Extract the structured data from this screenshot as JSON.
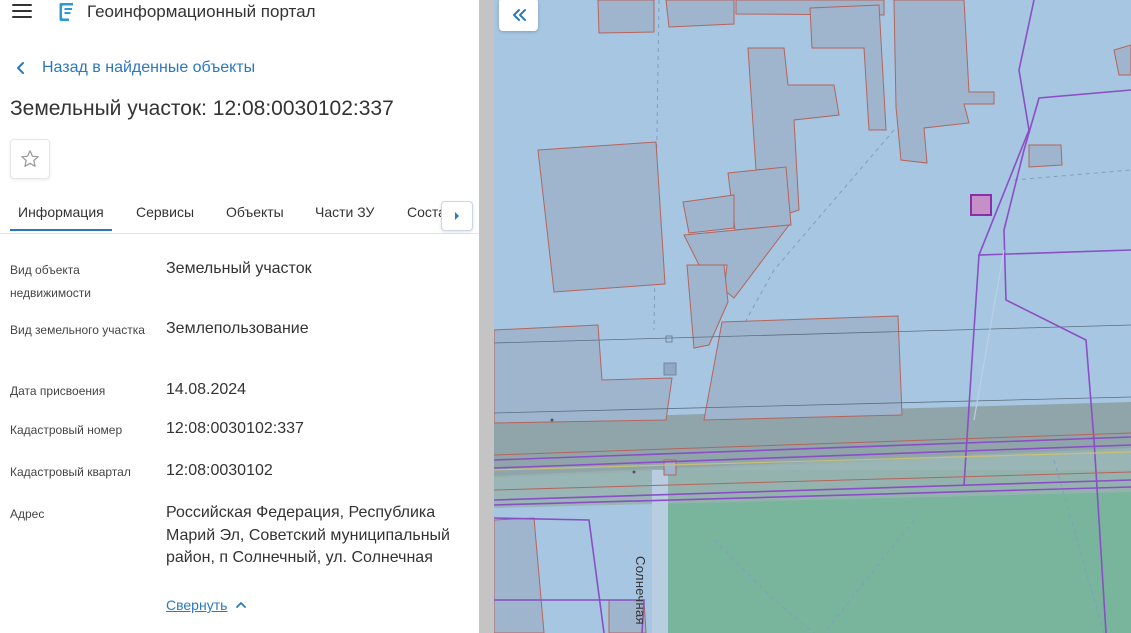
{
  "header": {
    "app_title": "Геоинформационный портал",
    "menu_icon": "hamburger-menu-icon",
    "logo_icon": "geoportal-logo-icon"
  },
  "back_link": {
    "label": "Назад в найденные объекты"
  },
  "object": {
    "title": "Земельный участок: 12:08:0030102:337"
  },
  "tabs": [
    {
      "label": "Информация",
      "active": true
    },
    {
      "label": "Сервисы",
      "active": false
    },
    {
      "label": "Объекты",
      "active": false
    },
    {
      "label": "Части ЗУ",
      "active": false
    },
    {
      "label": "Соста",
      "active": false
    }
  ],
  "details": [
    {
      "label": "Вид объекта недвижимости",
      "value": "Земельный участок"
    },
    {
      "label": "Вид земельного участка",
      "value": "Землепользование"
    },
    {
      "label": "Дата присвоения",
      "value": "14.08.2024"
    },
    {
      "label": "Кадастровый номер",
      "value": "12:08:0030102:337"
    },
    {
      "label": "Кадастровый квартал",
      "value": "12:08:0030102"
    },
    {
      "label": "Адрес",
      "value": "Российская Федерация, Республика Марий Эл, Советский муниципальный район, п Солнечный, ул. Солнечная"
    }
  ],
  "collapse_link": {
    "label": "Свернуть"
  },
  "map": {
    "street_label": "Солнечная",
    "colors": {
      "background": "#a7c6e1",
      "parcel_fill": "#9fb5cd",
      "parcel_stroke": "#b5645c",
      "boundary": "#8a4fc4",
      "road": "#8ea3a5",
      "green_zone": "#79b59d",
      "selected_parcel": "#c58fc8"
    }
  },
  "colors": {
    "accent": "#2b78c2",
    "text": "#333333",
    "divider": "#c4c4c4"
  }
}
